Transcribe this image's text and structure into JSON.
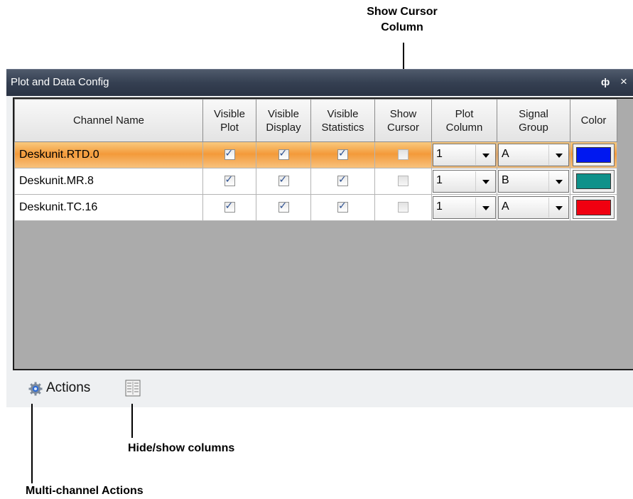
{
  "annotations": {
    "show_cursor_column": [
      "Show Cursor",
      "Column"
    ],
    "hide_show_columns": "Hide/show columns",
    "multi_channel_actions": "Multi-channel Actions"
  },
  "window": {
    "title": "Plot and Data Config",
    "pin_glyph": "ф",
    "close_glyph": "×"
  },
  "grid": {
    "headers": [
      [
        "Channel Name"
      ],
      [
        "Visible",
        "Plot"
      ],
      [
        "Visible",
        "Display"
      ],
      [
        "Visible",
        "Statistics"
      ],
      [
        "Show",
        "Cursor"
      ],
      [
        "Plot",
        "Column"
      ],
      [
        "Signal",
        "Group"
      ],
      [
        "Color"
      ]
    ],
    "rows": [
      {
        "channel": "Deskunit.RTD.0",
        "visible_plot": true,
        "visible_display": true,
        "visible_statistics": true,
        "show_cursor": false,
        "plot_column": "1",
        "signal_group": "A",
        "color": "#0018f0",
        "selected": true
      },
      {
        "channel": "Deskunit.MR.8",
        "visible_plot": true,
        "visible_display": true,
        "visible_statistics": true,
        "show_cursor": false,
        "plot_column": "1",
        "signal_group": "B",
        "color": "#0f918a",
        "selected": false
      },
      {
        "channel": "Deskunit.TC.16",
        "visible_plot": true,
        "visible_display": true,
        "visible_statistics": true,
        "show_cursor": false,
        "plot_column": "1",
        "signal_group": "A",
        "color": "#f00010",
        "selected": false
      }
    ]
  },
  "footer": {
    "actions_label": "Actions",
    "actions_icon": "gear-icon",
    "columns_icon": "columns-icon"
  }
}
